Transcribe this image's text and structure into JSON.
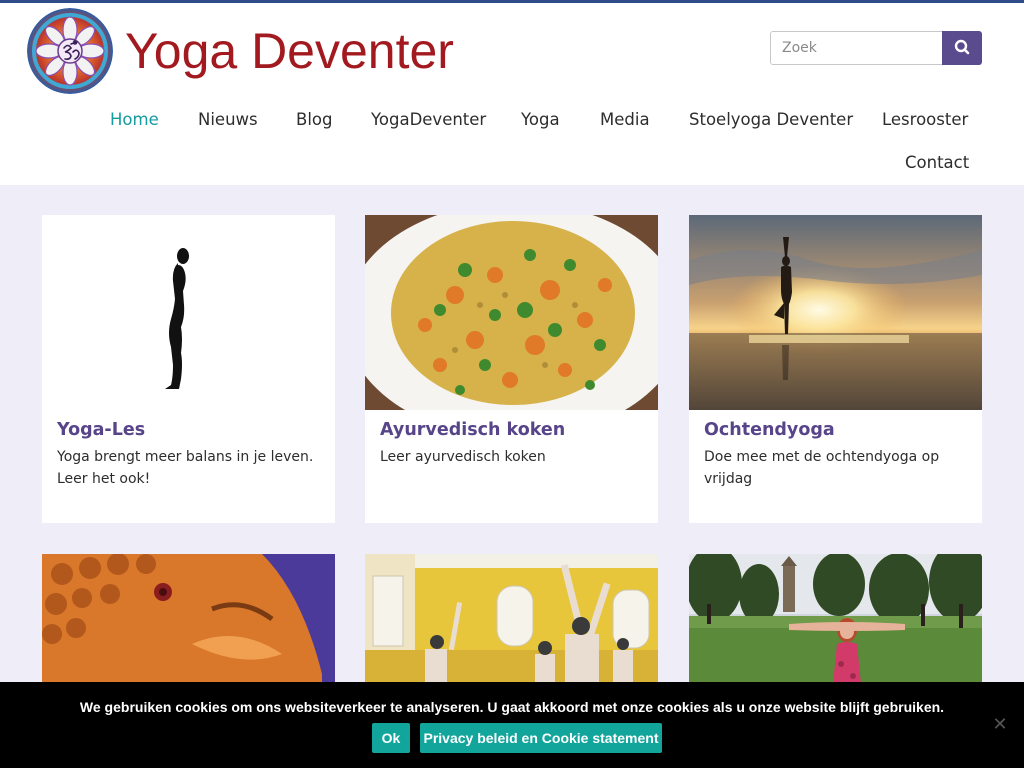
{
  "site": {
    "title": "Yoga Deventer"
  },
  "search": {
    "placeholder": "Zoek",
    "icon": "search-icon"
  },
  "nav": {
    "items": [
      "Home",
      "Nieuws",
      "Blog",
      "YogaDeventer",
      "Yoga",
      "Media",
      "Stoelyoga Deventer",
      "Lesrooster",
      "Contact"
    ],
    "active": "Home"
  },
  "cards": [
    {
      "title": "Yoga-Les",
      "text": "Yoga brengt meer balans in je leven. Leer het ook!"
    },
    {
      "title": "Ayurvedisch koken",
      "text": "Leer ayurvedisch koken"
    },
    {
      "title": "Ochtendyoga",
      "text": "Doe mee met de ochtendyoga op vrijdag"
    },
    {
      "title": "",
      "text": ""
    },
    {
      "title": "",
      "text": ""
    },
    {
      "title": "",
      "text": ""
    }
  ],
  "cookie": {
    "message": "We gebruiken cookies om ons websiteverkeer te analyseren. U gaat akkoord met onze cookies als u onze website blijft gebruiken.",
    "ok_label": "Ok",
    "policy_label": "Privacy beleid en Cookie statement",
    "close_icon": "close-icon"
  },
  "colors": {
    "title_red": "#a21a1f",
    "accent_purple": "#5a4a8e",
    "card_title_purple": "#584488",
    "nav_active_teal": "#159ba0",
    "cookie_button_teal": "#12a59c",
    "page_background": "#efedf7",
    "top_border_blue": "#2f4b8a"
  }
}
